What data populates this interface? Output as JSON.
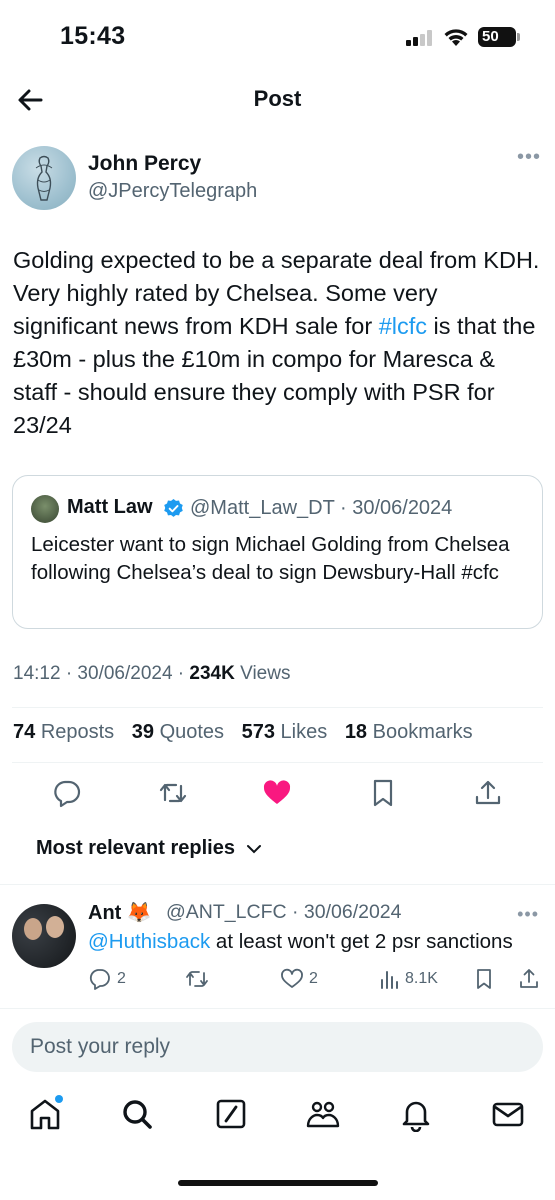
{
  "status_bar": {
    "time": "15:43",
    "battery": "50"
  },
  "header": {
    "title": "Post"
  },
  "author": {
    "name": "John Percy",
    "handle": "@JPercyTelegraph"
  },
  "post": {
    "text_before": "Golding expected to be a separate deal from KDH. Very highly rated by Chelsea. Some very significant news from KDH sale for ",
    "hashtag": "#lcfc",
    "text_after": " is that the £30m - plus the £10m in compo for Maresca & staff - should ensure they comply with PSR for 23/24"
  },
  "quote": {
    "name": "Matt Law",
    "handle_date": "@Matt_Law_DT · 30/06/2024",
    "text": "Leicester want to sign Michael Golding from Chelsea following Chelsea’s deal to sign Dewsbury-Hall #cfc"
  },
  "meta": {
    "time_date": "14:12 · 30/06/2024 · ",
    "views_count": "234K",
    "views_label": " Views"
  },
  "stats": [
    {
      "count": "74",
      "label": "Reposts"
    },
    {
      "count": "39",
      "label": "Quotes"
    },
    {
      "count": "573",
      "label": "Likes"
    },
    {
      "count": "18",
      "label": "Bookmarks"
    }
  ],
  "replies_sort": {
    "label": "Most relevant replies"
  },
  "reply": {
    "name": "Ant 🦊",
    "handle_date": "@ANT_LCFC · 30/06/2024",
    "mention": "@Huthisback",
    "text": " at least won't get 2 psr sanctions",
    "reply_count": "2",
    "like_count": "2",
    "views": "8.1K"
  },
  "compose": {
    "placeholder": "Post your reply"
  },
  "colors": {
    "accent": "#1d9bf0",
    "like": "#f91880",
    "text": "#0f1419",
    "muted": "#536471"
  },
  "icons": [
    "back-arrow-icon",
    "more-icon",
    "verified-icon",
    "reply-icon",
    "repost-icon",
    "like-icon",
    "bookmark-icon",
    "share-icon",
    "views-icon",
    "home-icon",
    "search-icon",
    "grok-icon",
    "communities-icon",
    "notifications-icon",
    "messages-icon"
  ]
}
